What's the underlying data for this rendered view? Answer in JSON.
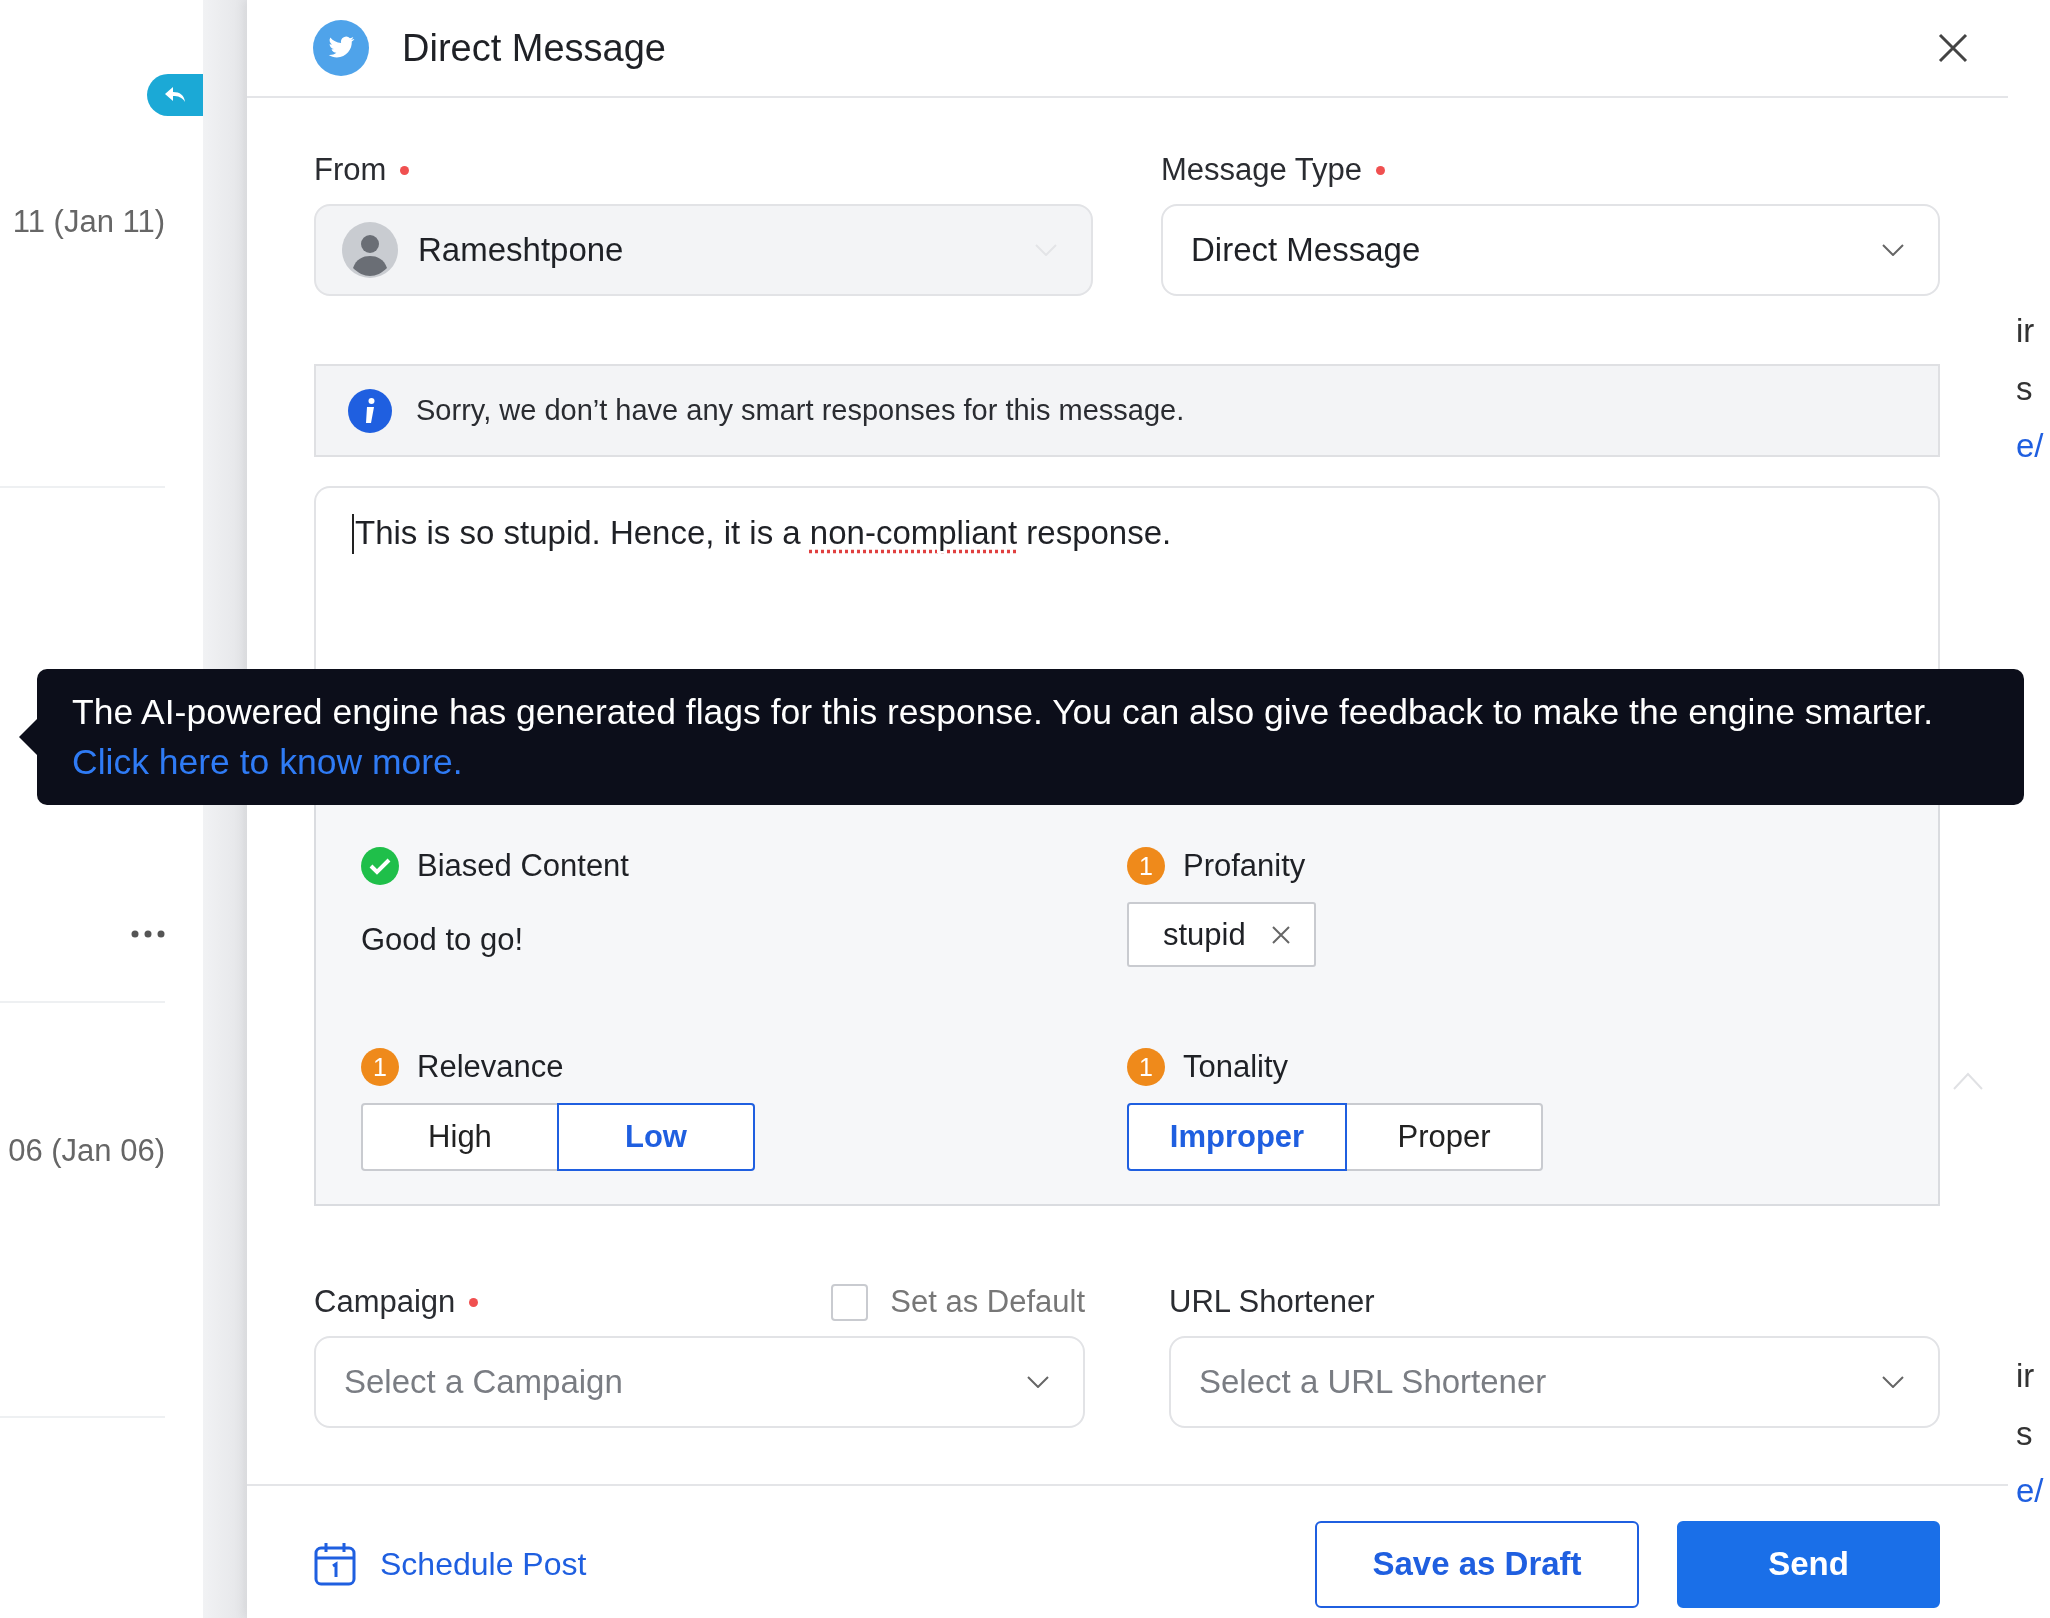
{
  "background_left": {
    "items": [
      {
        "kind": "date",
        "text": "11 (Jan 11)"
      },
      {
        "kind": "more"
      },
      {
        "kind": "date",
        "text": "06 (Jan 06)"
      }
    ]
  },
  "background_right": {
    "fragments": [
      {
        "kind": "text",
        "text": "ir"
      },
      {
        "kind": "text",
        "text": "s"
      },
      {
        "kind": "link",
        "text": "e/"
      },
      {
        "kind": "text",
        "text": "ir"
      },
      {
        "kind": "text",
        "text": "s"
      },
      {
        "kind": "link",
        "text": "e/"
      }
    ]
  },
  "dialog": {
    "title": "Direct Message",
    "from": {
      "label": "From",
      "required": true,
      "value": "Rameshtpone"
    },
    "message_type": {
      "label": "Message Type",
      "required": true,
      "value": "Direct Message"
    },
    "info": "Sorry, we don’t have any smart responses for this message.",
    "message": [
      {
        "text": "This is so stupid. Hence, it is a ",
        "misspelled": false
      },
      {
        "text": "non-compliant",
        "misspelled": true
      },
      {
        "text": " response.",
        "misspelled": false
      }
    ],
    "tooltip": {
      "text": "The AI-powered engine has generated flags for this response. You can also give feedback to make the engine smarter.",
      "link": "Click here to know more."
    },
    "flags": [
      {
        "title": "Biased Content",
        "flagged": false,
        "kind": "text",
        "text": "Good to go!"
      },
      {
        "title": "Profanity",
        "flagged": true,
        "count": "1",
        "kind": "tags",
        "tags": [
          "stupid"
        ]
      },
      {
        "title": "Relevance",
        "flagged": true,
        "count": "1",
        "kind": "toggle",
        "options": [
          {
            "label": "High",
            "selected": false
          },
          {
            "label": "Low",
            "selected": true
          }
        ]
      },
      {
        "title": "Tonality",
        "flagged": true,
        "count": "1",
        "kind": "toggle",
        "options": [
          {
            "label": "Improper",
            "selected": true
          },
          {
            "label": "Proper",
            "selected": false
          }
        ]
      }
    ],
    "campaign": {
      "label": "Campaign",
      "required": true,
      "placeholder": "Select a Campaign",
      "default_label": "Set as Default",
      "default_checked": false
    },
    "url_shortener": {
      "label": "URL Shortener",
      "required": false,
      "placeholder": "Select a URL Shortener"
    },
    "schedule": "Schedule Post",
    "buttons": [
      {
        "kind": "secondary",
        "label": "Save as Draft"
      },
      {
        "kind": "primary",
        "label": "Send"
      }
    ]
  }
}
